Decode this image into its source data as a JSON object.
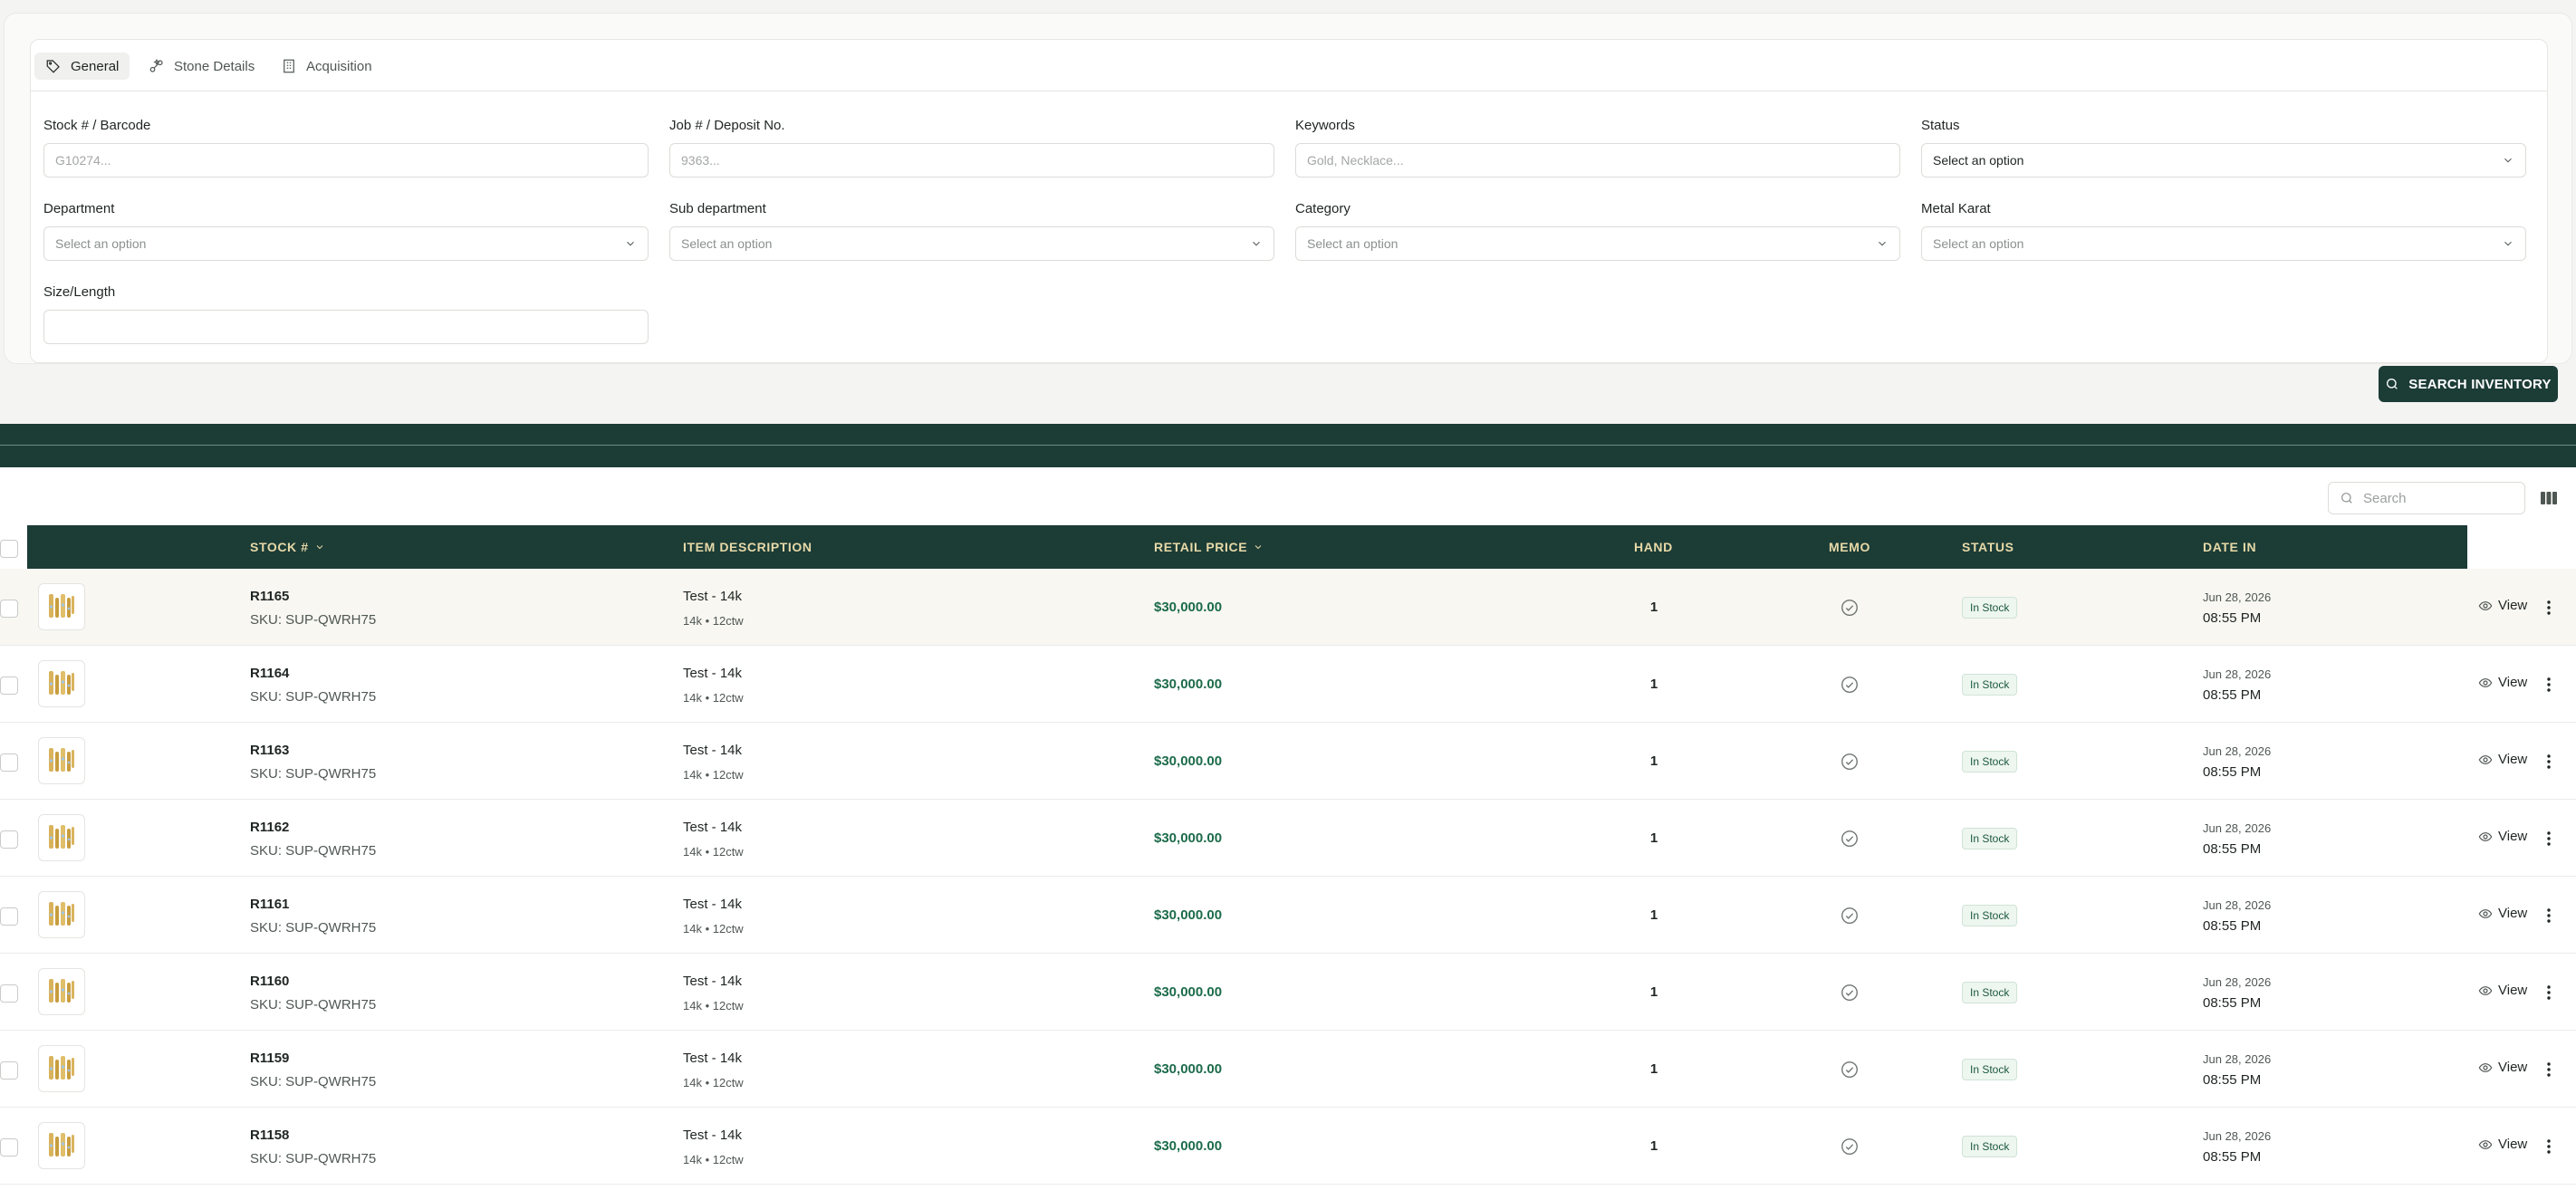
{
  "tabs": [
    {
      "label": "General",
      "icon": "tag-icon"
    },
    {
      "label": "Stone Details",
      "icon": "stones-icon"
    },
    {
      "label": "Acquisition",
      "icon": "building-icon"
    }
  ],
  "filters": {
    "stock": {
      "label": "Stock # / Barcode",
      "placeholder": "G10274..."
    },
    "job": {
      "label": "Job # / Deposit No.",
      "placeholder": "9363..."
    },
    "keywords": {
      "label": "Keywords",
      "placeholder": "Gold, Necklace..."
    },
    "status": {
      "label": "Status",
      "value": "Select an option"
    },
    "department": {
      "label": "Department",
      "value": "Select an option"
    },
    "sub_department": {
      "label": "Sub department",
      "value": "Select an option"
    },
    "category": {
      "label": "Category",
      "value": "Select an option"
    },
    "metal_karat": {
      "label": "Metal Karat",
      "value": "Select an option"
    },
    "size": {
      "label": "Size/Length",
      "placeholder": ""
    }
  },
  "search_button": {
    "label": "SEARCH INVENTORY"
  },
  "table": {
    "search_placeholder": "Search",
    "columns": {
      "stock": "STOCK #",
      "description": "ITEM DESCRIPTION",
      "price": "RETAIL PRICE",
      "hand": "HAND",
      "memo": "MEMO",
      "status": "STATUS",
      "date": "DATE IN"
    },
    "view_label": "View",
    "rows": [
      {
        "stock": "R1165",
        "sku": "SKU: SUP-QWRH75",
        "desc": "Test - 14k",
        "sub": "14k • 12ctw",
        "price": "$30,000.00",
        "hand": "1",
        "status": "In Stock",
        "date": "Jun 28, 2026",
        "time": "08:55 PM"
      },
      {
        "stock": "R1164",
        "sku": "SKU: SUP-QWRH75",
        "desc": "Test - 14k",
        "sub": "14k • 12ctw",
        "price": "$30,000.00",
        "hand": "1",
        "status": "In Stock",
        "date": "Jun 28, 2026",
        "time": "08:55 PM"
      },
      {
        "stock": "R1163",
        "sku": "SKU: SUP-QWRH75",
        "desc": "Test - 14k",
        "sub": "14k • 12ctw",
        "price": "$30,000.00",
        "hand": "1",
        "status": "In Stock",
        "date": "Jun 28, 2026",
        "time": "08:55 PM"
      },
      {
        "stock": "R1162",
        "sku": "SKU: SUP-QWRH75",
        "desc": "Test - 14k",
        "sub": "14k • 12ctw",
        "price": "$30,000.00",
        "hand": "1",
        "status": "In Stock",
        "date": "Jun 28, 2026",
        "time": "08:55 PM"
      },
      {
        "stock": "R1161",
        "sku": "SKU: SUP-QWRH75",
        "desc": "Test - 14k",
        "sub": "14k • 12ctw",
        "price": "$30,000.00",
        "hand": "1",
        "status": "In Stock",
        "date": "Jun 28, 2026",
        "time": "08:55 PM"
      },
      {
        "stock": "R1160",
        "sku": "SKU: SUP-QWRH75",
        "desc": "Test - 14k",
        "sub": "14k • 12ctw",
        "price": "$30,000.00",
        "hand": "1",
        "status": "In Stock",
        "date": "Jun 28, 2026",
        "time": "08:55 PM"
      },
      {
        "stock": "R1159",
        "sku": "SKU: SUP-QWRH75",
        "desc": "Test - 14k",
        "sub": "14k • 12ctw",
        "price": "$30,000.00",
        "hand": "1",
        "status": "In Stock",
        "date": "Jun 28, 2026",
        "time": "08:55 PM"
      },
      {
        "stock": "R1158",
        "sku": "SKU: SUP-QWRH75",
        "desc": "Test - 14k",
        "sub": "14k • 12ctw",
        "price": "$30,000.00",
        "hand": "1",
        "status": "In Stock",
        "date": "Jun 28, 2026",
        "time": "08:55 PM"
      }
    ]
  },
  "colors": {
    "brand_dark": "#1c3c36",
    "header_text": "#e7d9a8",
    "price_green": "#1c6b4a"
  }
}
